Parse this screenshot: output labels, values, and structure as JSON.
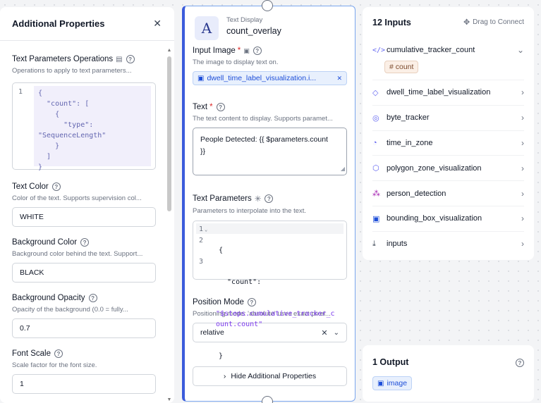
{
  "left_panel": {
    "title": "Additional Properties",
    "fields": {
      "ops": {
        "label": "Text Parameters Operations",
        "desc": "Operations to apply to text parameters..."
      },
      "color": {
        "label": "Text Color",
        "desc": "Color of the text. Supports supervision col...",
        "value": "WHITE"
      },
      "bgcolor": {
        "label": "Background Color",
        "desc": "Background color behind the text. Support...",
        "value": "BLACK"
      },
      "opacity": {
        "label": "Background Opacity",
        "desc": "Opacity of the background (0.0 = fully...",
        "value": "0.7"
      },
      "scale": {
        "label": "Font Scale",
        "desc": "Scale factor for the font size.",
        "value": "1"
      }
    },
    "ops_code": {
      "line_number": "1",
      "text": "{\n  \"count\": [\n    {\n      \"type\":\n\"SequenceLength\"\n    }\n  ]\n}"
    }
  },
  "node": {
    "type_label": "Text Display",
    "name": "count_overlay",
    "icon_glyph": "A",
    "input_image": {
      "label": "Input Image",
      "desc": "The image to display text on.",
      "chip": "dwell_time_label_visualization.i..."
    },
    "text": {
      "label": "Text",
      "desc": "The text content to display. Supports paramet...",
      "value_line1": "People Detected: {{ $parameters.count",
      "value_line2": "}}"
    },
    "text_parameters": {
      "label": "Text Parameters",
      "desc": "Parameters to interpolate into the text.",
      "line_numbers": [
        "1",
        "2",
        "3"
      ],
      "code_open": "{",
      "code_key": "  \"count\":",
      "code_value": "\"$steps.cumulative_tracker_c\nount.count\"",
      "code_close": "}"
    },
    "position_mode": {
      "label": "Position Mode",
      "desc": "Positioning mode: 'absolute' uses exact pixel...",
      "value": "relative"
    },
    "hide_button": "Hide Additional Properties"
  },
  "inputs_panel": {
    "title": "12 Inputs",
    "drag_label": "Drag to Connect",
    "items": [
      {
        "name": "cumulative_tracker_count",
        "icon": "code-icon",
        "expanded": true,
        "badge": "# count"
      },
      {
        "name": "dwell_time_label_visualization",
        "icon": "tag-icon"
      },
      {
        "name": "byte_tracker",
        "icon": "target-icon"
      },
      {
        "name": "time_in_zone",
        "icon": "timer-icon"
      },
      {
        "name": "polygon_zone_visualization",
        "icon": "hexagon-icon"
      },
      {
        "name": "person_detection",
        "icon": "nodes-icon"
      },
      {
        "name": "bounding_box_visualization",
        "icon": "image-box-icon"
      },
      {
        "name": "inputs",
        "icon": "download-icon"
      }
    ]
  },
  "outputs_panel": {
    "title": "1 Output",
    "chip": "image"
  }
}
